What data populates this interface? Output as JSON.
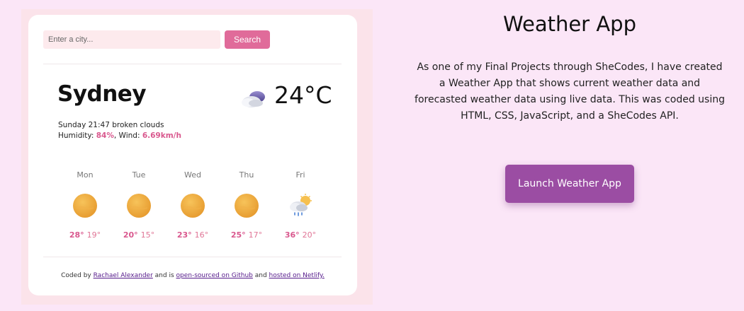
{
  "weather_app": {
    "search": {
      "placeholder": "Enter a city...",
      "button_label": "Search"
    },
    "current": {
      "city": "Sydney",
      "icon": "night-cloud-icon",
      "temperature": "24°C",
      "date_description": "Sunday 21:47 broken clouds",
      "humidity_label": "Humidity: ",
      "humidity_value": "84%",
      "wind_label": ", Wind: ",
      "wind_value": "6.69km/h"
    },
    "forecast": [
      {
        "day": "Mon",
        "icon": "sun-icon",
        "max": "28°",
        "min": "19°"
      },
      {
        "day": "Tue",
        "icon": "sun-icon",
        "max": "20°",
        "min": "15°"
      },
      {
        "day": "Wed",
        "icon": "sun-icon",
        "max": "23°",
        "min": "16°"
      },
      {
        "day": "Thu",
        "icon": "sun-icon",
        "max": "25°",
        "min": "17°"
      },
      {
        "day": "Fri",
        "icon": "rain-cloud-icon",
        "max": "36°",
        "min": "20°"
      }
    ],
    "footer": {
      "prefix": "Coded by ",
      "author_link": "Rachael Alexander",
      "middle": " and is ",
      "github_link": "open-sourced on Github",
      "and": " and ",
      "netlify_link": "hosted on Netlify."
    }
  },
  "project": {
    "title": "Weather App",
    "description": "As one of my  Final  Projects through SheCodes,  I have created a Weather App that shows current weather data and forecasted weather data using live data. This was coded using  HTML, CSS, JavaScript, and a SheCodes API.",
    "launch_label": "Launch Weather App"
  },
  "colors": {
    "page_background": "#fbe6f7",
    "accent_pink": "#e06b9a",
    "launch_purple": "#9b4da3"
  }
}
